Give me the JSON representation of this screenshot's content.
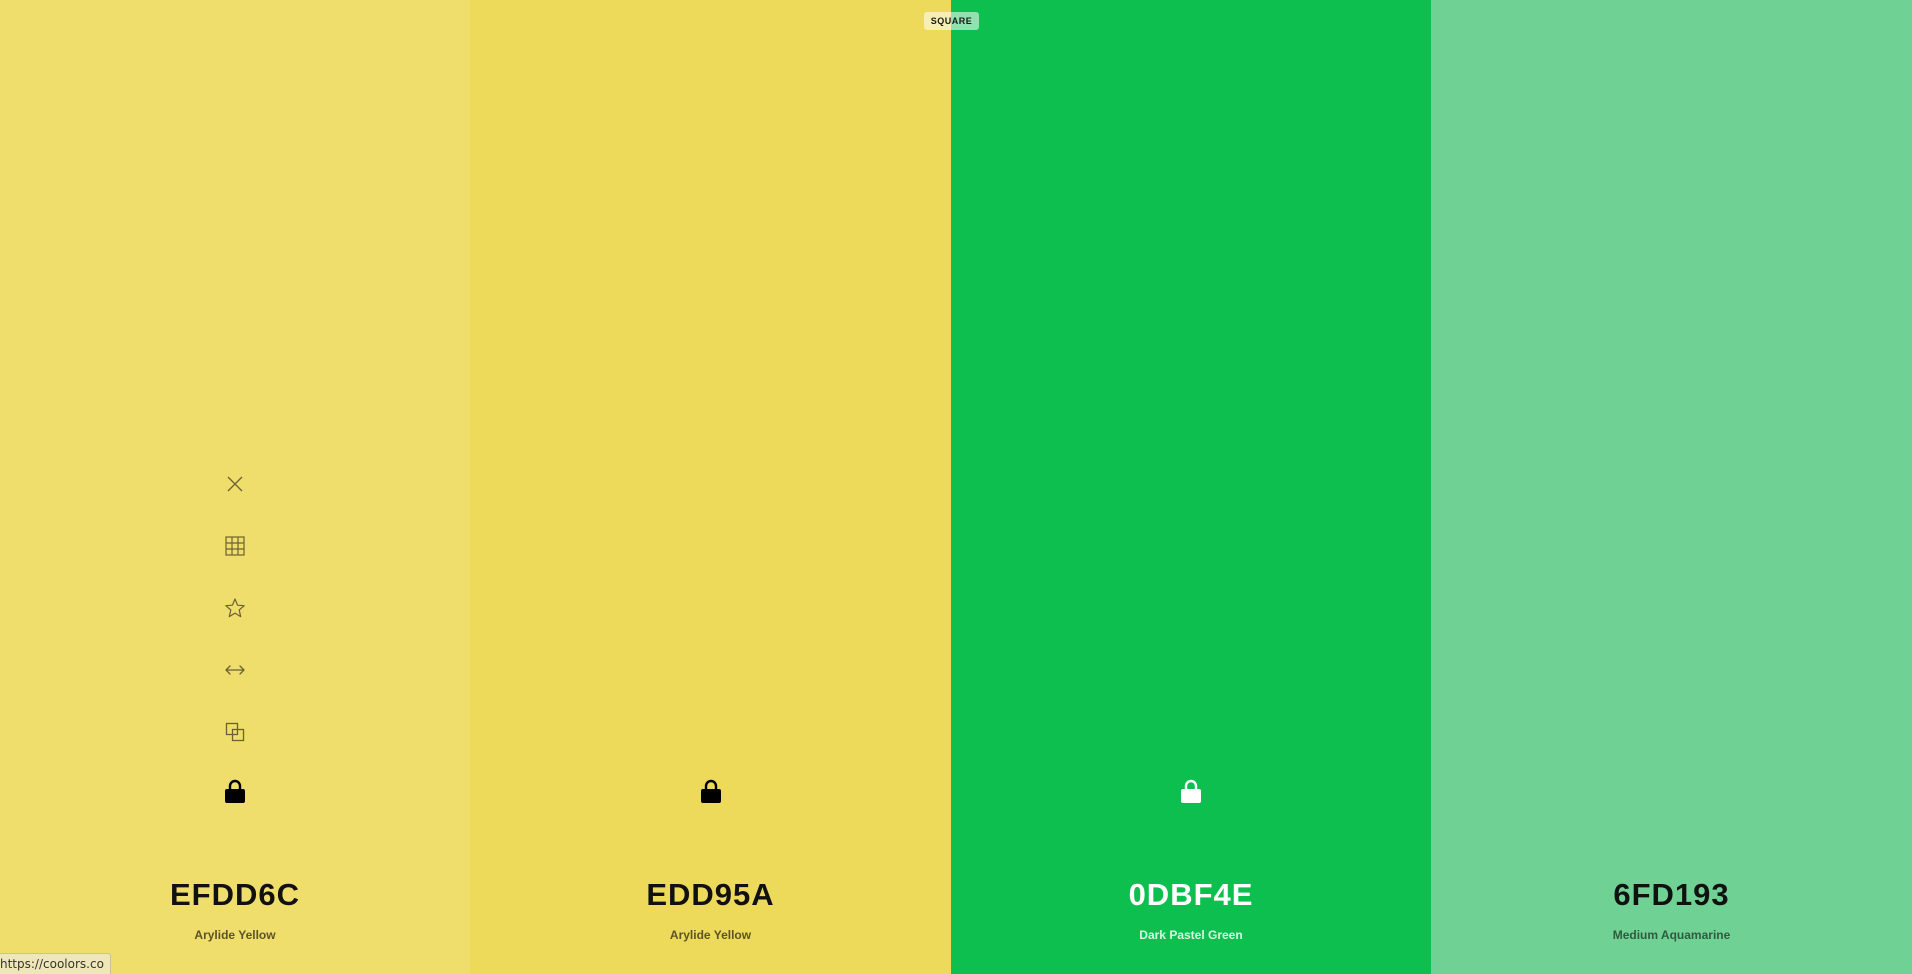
{
  "mode_badge": "SQUARE",
  "status_url": "https://coolors.co",
  "swatches": [
    {
      "hex": "EFDD6C",
      "name": "Arylide Yellow",
      "bg": "#EFDD6C",
      "text_color": "#111111",
      "name_color": "#5c5426",
      "lock_color": "#000000"
    },
    {
      "hex": "EDD95A",
      "name": "Arylide Yellow",
      "bg": "#EDD95A",
      "text_color": "#111111",
      "name_color": "#5c5426",
      "lock_color": "#000000"
    },
    {
      "hex": "0DBF4E",
      "name": "Dark Pastel Green",
      "bg": "#0DBF4E",
      "text_color": "#ffffff",
      "name_color": "#d8f5e2",
      "lock_color": "#ffffff"
    },
    {
      "hex": "6FD193",
      "name": "Medium Aquamarine",
      "bg": "#6FD193",
      "text_color": "#111111",
      "name_color": "#2f5a3e",
      "lock_color": "#000000"
    }
  ],
  "tool_icons": [
    "close-icon",
    "grid-icon",
    "star-icon",
    "drag-arrows-icon",
    "copy-icon",
    "lock-icon"
  ],
  "tool_icon_color": "#6b6233"
}
